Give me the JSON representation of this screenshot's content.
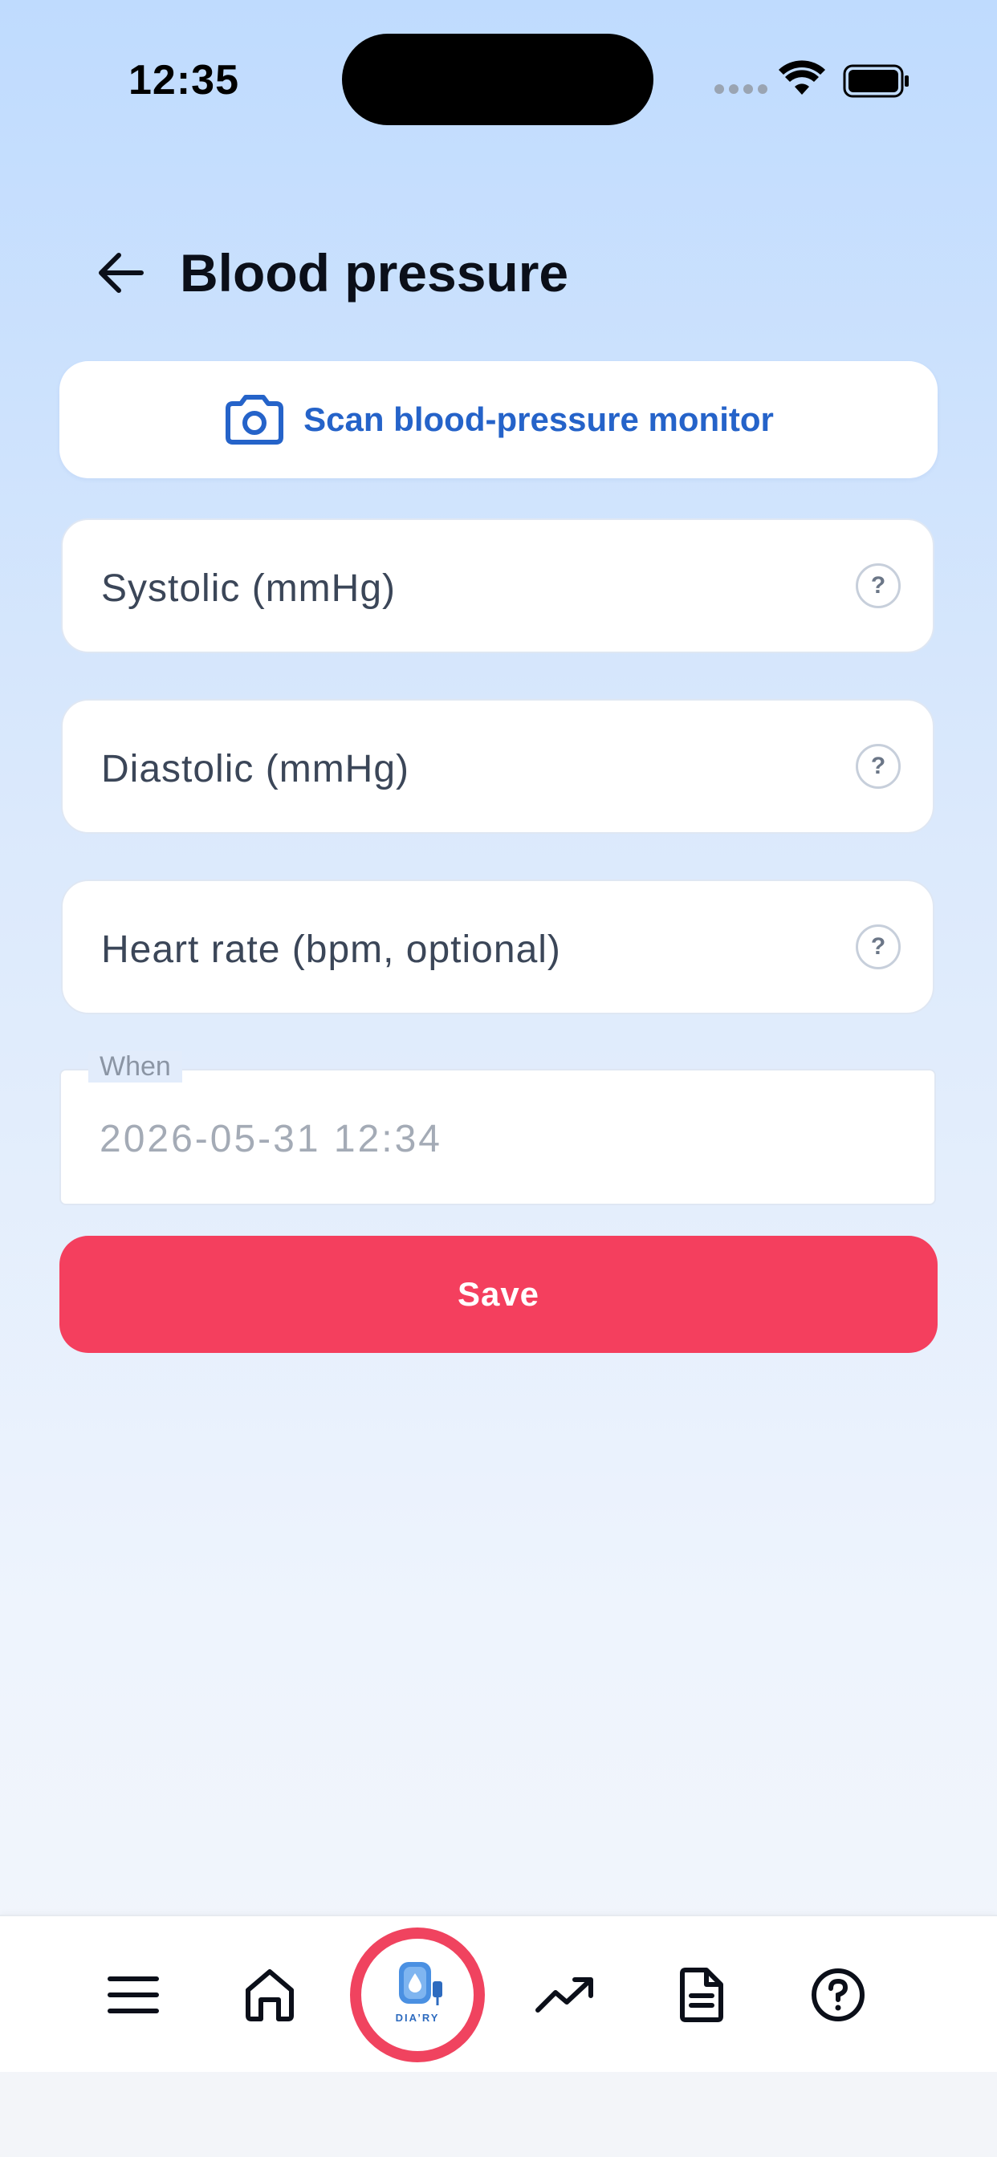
{
  "status_bar": {
    "time": "12:35"
  },
  "header": {
    "title": "Blood pressure"
  },
  "scan_button": {
    "label": "Scan blood-pressure monitor"
  },
  "fields": {
    "systolic": {
      "placeholder": "Systolic (mmHg)"
    },
    "diastolic": {
      "placeholder": "Diastolic (mmHg)"
    },
    "heart_rate": {
      "placeholder": "Heart rate (bpm, optional)"
    },
    "help_glyph": "?"
  },
  "when": {
    "label": "When",
    "value": "2026-05-31  12:34"
  },
  "save_button": {
    "label": "Save"
  },
  "bottom_nav": {
    "logo_text": "DIA’RY",
    "items": [
      "menu-icon",
      "home-icon",
      "app-logo",
      "trending-up-icon",
      "document-icon",
      "help-circle-icon"
    ]
  },
  "colors": {
    "accent_blue": "#2563c9",
    "save_red": "#f43f5e",
    "nav_ring": "#f0435f"
  }
}
